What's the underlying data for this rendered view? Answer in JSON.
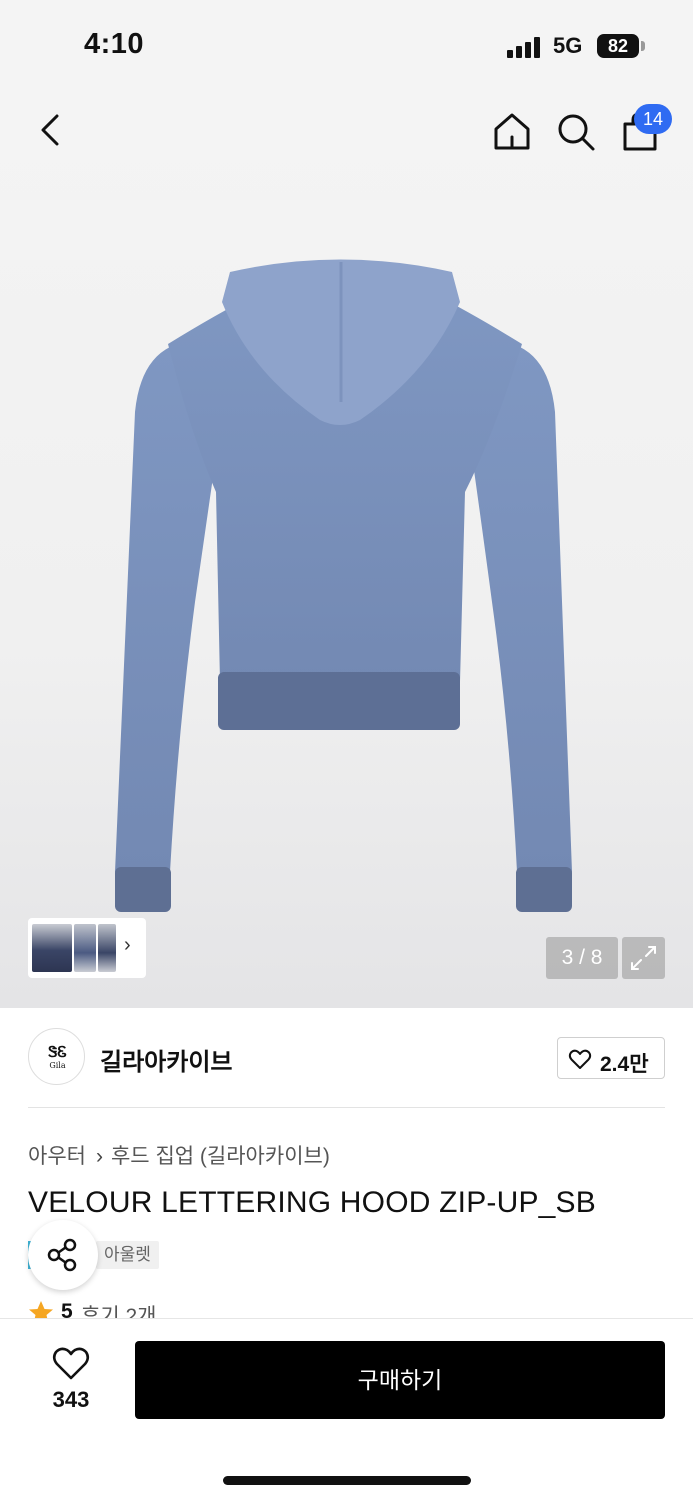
{
  "status_bar": {
    "time": "4:10",
    "network": "5G",
    "battery": "82"
  },
  "header": {
    "icons": [
      "back-icon",
      "home-icon",
      "search-icon",
      "bag-icon"
    ],
    "cart_badge": "14",
    "badge_color": "#2f6bf2"
  },
  "gallery": {
    "page_indicator": "3 / 8",
    "current_page": 3,
    "total_pages": 8,
    "thumb_arrow": "›"
  },
  "brand": {
    "logo_mark": "Gila",
    "name": "길라아카이브",
    "follow_count": "2.4만"
  },
  "product": {
    "breadcrumb": [
      "아우터",
      "후드 집업 (길라아카이브)"
    ],
    "breadcrumb_separator": "›",
    "title": "VELOUR LETTERING HOOD ZIP-UP_SB",
    "tag": "아울렛",
    "rating": "5",
    "review_count": "후기 2개",
    "star_color": "#f5a623"
  },
  "bottom_bar": {
    "like_count": "343",
    "buy_label": "구매하기"
  }
}
